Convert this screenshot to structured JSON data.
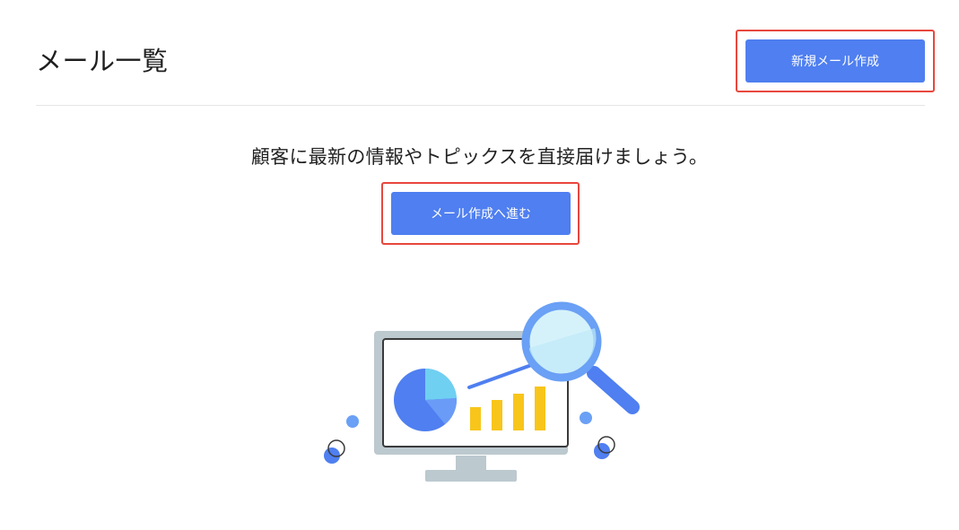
{
  "header": {
    "title": "メール一覧",
    "new_mail_button": "新規メール作成"
  },
  "empty_state": {
    "message": "顧客に最新の情報やトピックスを直接届けましょう。",
    "cta_button": "メール作成へ進む"
  },
  "illustration": {
    "description_icon": "analytics-monitor-illustration",
    "colors": {
      "primary": "#4f7ff0",
      "light_blue": "#6fd0f2",
      "yellow": "#f8c51a",
      "monitor_frame": "#bcc9cf",
      "highlight_red": "#e8473d"
    }
  }
}
